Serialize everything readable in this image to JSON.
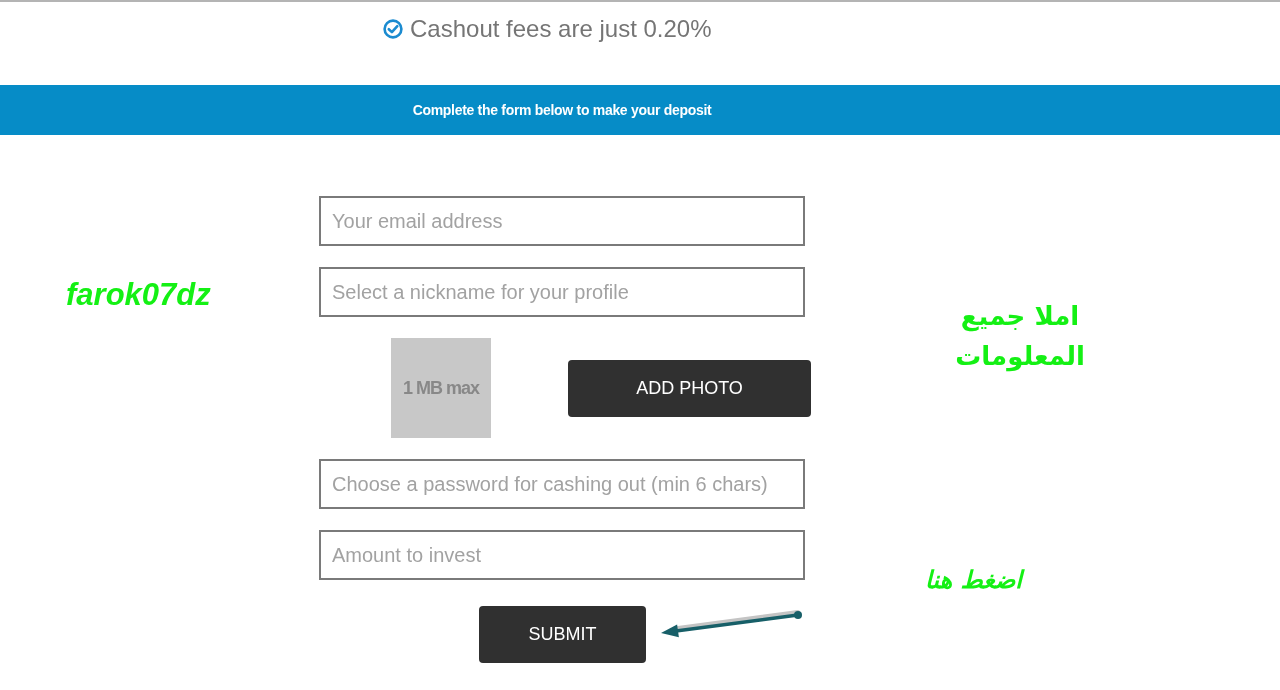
{
  "header": {
    "text": "Cashout fees are just 0.20%"
  },
  "banner": {
    "text": "Complete the form below to make your deposit"
  },
  "form": {
    "rows": [
      {
        "kind": "field",
        "placeholder": "Your email address"
      },
      {
        "kind": "field",
        "placeholder": "Select a nickname for your profile"
      },
      {
        "kind": "photo",
        "preview_text": "1 MB max",
        "button": "ADD PHOTO"
      },
      {
        "kind": "field",
        "placeholder": "Choose a password for cashing out (min 6 chars)"
      },
      {
        "kind": "field",
        "placeholder": "Amount to invest"
      }
    ],
    "submit": "SUBMIT"
  },
  "annotations": [
    {
      "kind": "signature",
      "text": "farok07dz"
    },
    {
      "kind": "note",
      "text": "املا جميع المعلومات"
    },
    {
      "kind": "note",
      "text": "اضغط هنا"
    },
    {
      "kind": "arrow"
    }
  ]
}
